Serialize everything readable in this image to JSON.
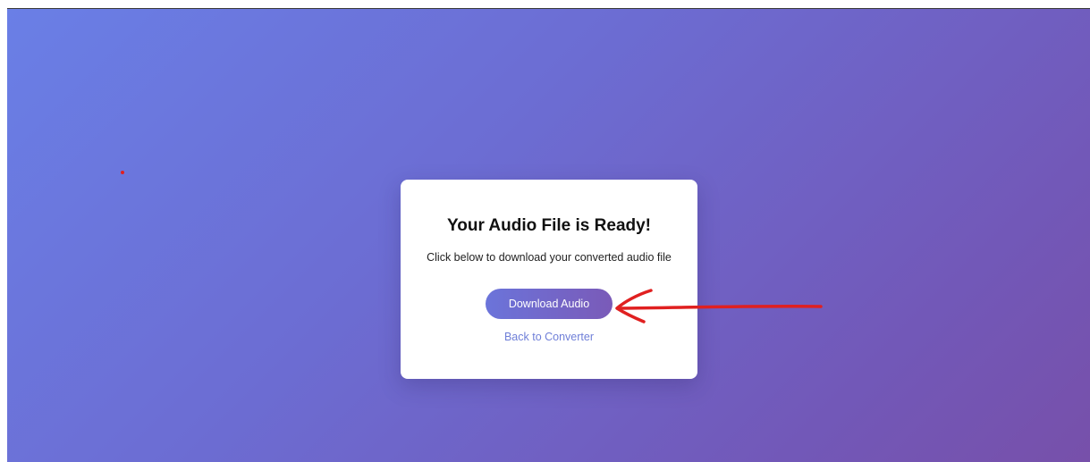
{
  "card": {
    "title": "Your Audio File is Ready!",
    "subtitle": "Click below to download your converted audio file",
    "download_label": "Download Audio",
    "back_label": "Back to Converter"
  },
  "colors": {
    "gradient_start": "#6a7fe6",
    "gradient_end": "#7750aa",
    "annotation": "#e02020",
    "link": "#6f7fd8"
  },
  "annotations": {
    "arrow_icon": "red-arrow-icon",
    "dot_icon": "red-dot-icon"
  }
}
